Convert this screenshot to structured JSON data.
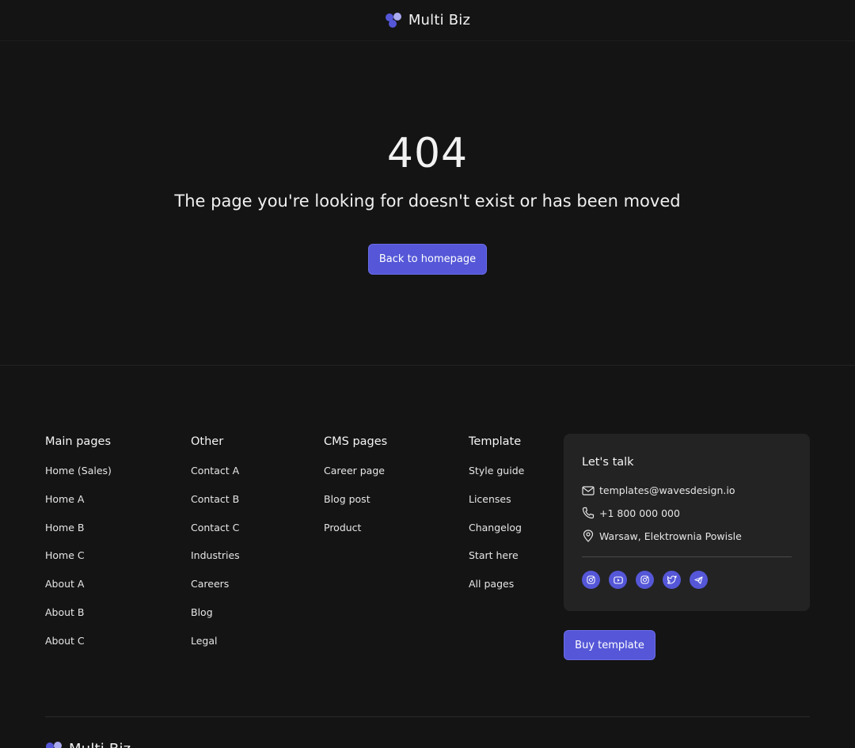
{
  "header": {
    "brand": "Multi Biz"
  },
  "hero": {
    "code": "404",
    "message": "The page you're looking for doesn't exist or has been moved",
    "button_label": "Back to homepage"
  },
  "footer": {
    "columns": [
      {
        "title": "Main pages",
        "links": [
          "Home (Sales)",
          "Home A",
          "Home B",
          "Home C",
          "About A",
          "About B",
          "About C"
        ]
      },
      {
        "title": "Other",
        "links": [
          "Contact A",
          "Contact B",
          "Contact C",
          "Industries",
          "Careers",
          "Blog",
          "Legal"
        ]
      },
      {
        "title": "CMS pages",
        "links": [
          "Career page",
          "Blog post",
          "Product"
        ]
      },
      {
        "title": "Template",
        "links": [
          "Style guide",
          "Licenses",
          "Changelog",
          "Start here",
          "All pages"
        ]
      }
    ],
    "contact": {
      "title": "Let's talk",
      "email": "templates@wavesdesign.io",
      "phone": "+1 800 000 000",
      "address": "Warsaw, Elektrownia Powisle",
      "socials": [
        "instagram-icon",
        "youtube-icon",
        "instagram-icon",
        "twitter-icon",
        "telegram-icon"
      ]
    },
    "buy_label": "Buy template",
    "bottom_brand": "Multi Biz"
  },
  "colors": {
    "background": "#141414",
    "accent": "#5557d8",
    "card": "#232323"
  }
}
